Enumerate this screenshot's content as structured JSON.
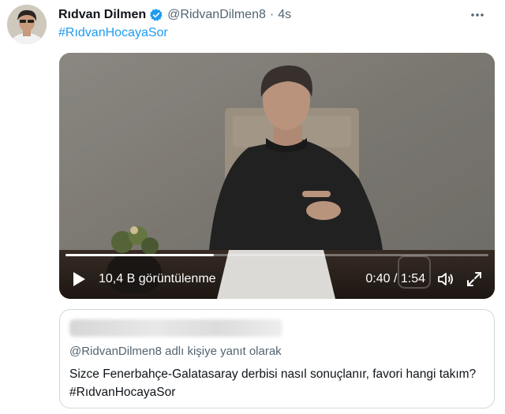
{
  "tweet": {
    "author_name": "Rıdvan Dilmen",
    "author_handle": "@RidvanDilmen8",
    "separator": "·",
    "time": "4s",
    "hashtag": "#RıdvanHocayaSor",
    "verified": true
  },
  "video": {
    "views": "10,4 B görüntülenme",
    "timecode": "0:40 / 1:54",
    "progress": 0.35,
    "icons": [
      "play-icon",
      "volume-icon",
      "fullscreen-icon"
    ]
  },
  "quote": {
    "reply_context": "@RidvanDilmen8 adlı kişiye yanıt olarak",
    "text": "Sizce Fenerbahçe-Galatasaray derbisi nasıl sonuçlanır, favori hangi takım? #RıdvanHocayaSor"
  },
  "colors": {
    "link": "#1d9bf0",
    "secondary_text": "#536471",
    "primary_text": "#0f1419",
    "border": "#cfd9de"
  }
}
